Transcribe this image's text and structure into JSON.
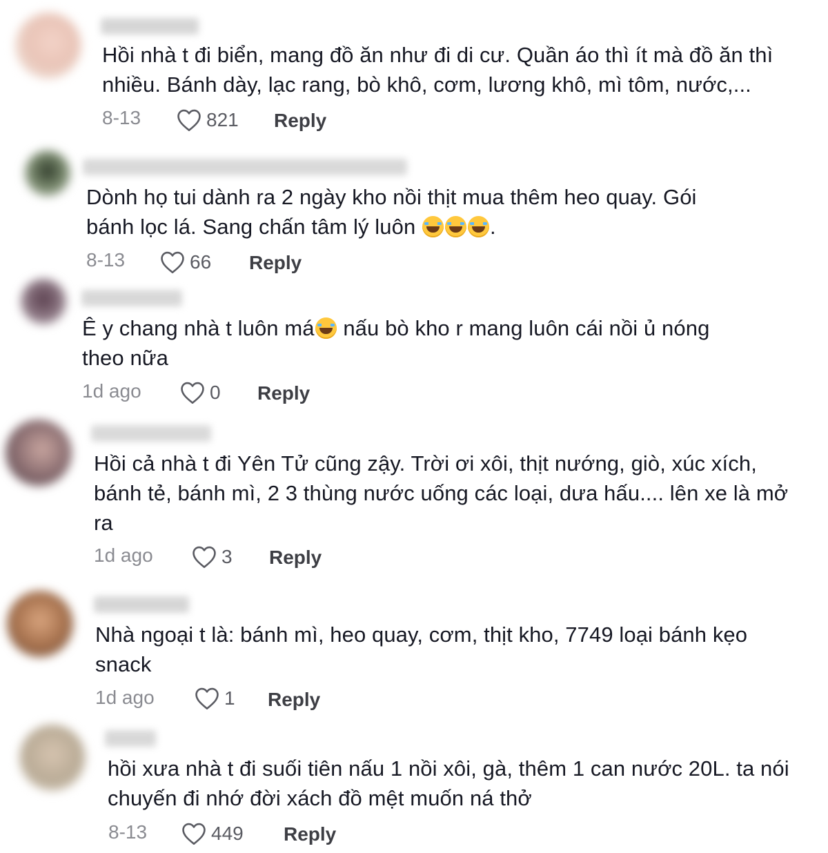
{
  "comments": [
    {
      "text": "Hồi nhà t đi biển, mang đồ ăn như đi di cư. Quần áo thì ít mà đồ ăn thì\nnhiều. Bánh dày, lạc rang, bò khô, cơm, lương khô, mì tôm, nước,...",
      "date": "8-13",
      "likes": "821",
      "reply": "Reply"
    },
    {
      "text_before": "Dònh họ tui dành ra 2 ngày kho nồi thịt mua thêm heo quay. Gói\nbánh lọc lá. Sang chấn tâm lý luôn ",
      "text_after": ".",
      "emoji": "face-with-tears-of-joy-icon",
      "date": "8-13",
      "likes": "66",
      "reply": "Reply"
    },
    {
      "text_before": "Ê y chang nhà t luôn má",
      "text_after": " nấu bò kho r mang luôn cái nồi ủ nóng\ntheo nữa",
      "emoji": "face-with-tears-of-joy-icon",
      "date": "1d ago",
      "likes": "0",
      "reply": "Reply"
    },
    {
      "text": "Hồi cả nhà t đi Yên Tử cũng zậy. Trời ơi xôi, thịt nướng, giò, xúc xích,\nbánh tẻ, bánh mì, 2 3 thùng nước uống các loại, dưa hấu.... lên xe là mở\nra",
      "date": "1d ago",
      "likes": "3",
      "reply": "Reply"
    },
    {
      "text": "Nhà ngoại t là: bánh mì, heo quay, cơm, thịt kho, 7749 loại bánh kẹo\nsnack",
      "date": "1d ago",
      "likes": "1",
      "reply": "Reply"
    },
    {
      "text": "hồi xưa nhà t đi suối tiên nấu 1 nồi xôi, gà, thêm 1 can nước 20L. ta nói\nchuyến đi nhớ đời xách đồ mệt muốn ná thở",
      "date": "8-13",
      "likes": "449",
      "reply": "Reply"
    }
  ],
  "colors": {
    "text": "#161823",
    "date": "#8a8b91",
    "reply": "#3d3e44",
    "heart_outline": "#5a5b62"
  },
  "icons": {
    "like": "heart-outline-icon"
  }
}
